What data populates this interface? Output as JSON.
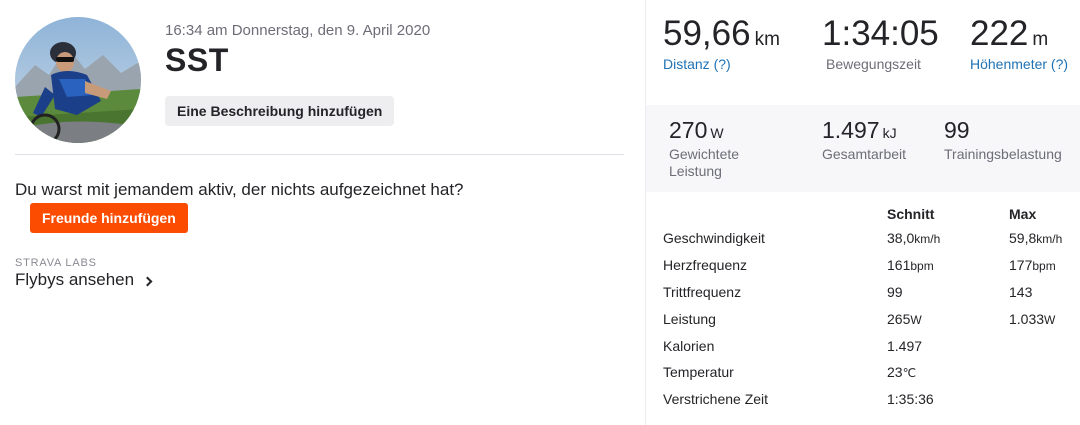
{
  "activity": {
    "timestamp": "16:34 am Donnerstag, den 9. April 2020",
    "name": "SST",
    "add_description_label": "Eine Beschreibung hinzufügen"
  },
  "social": {
    "prompt": "Du warst mit jemandem aktiv, der nichts aufgezeichnet hat?",
    "add_friends_label": "Freunde hinzufügen"
  },
  "labs": {
    "label": "STRAVA LABS",
    "flybys_label": "Flybys ansehen"
  },
  "summary": {
    "distance": {
      "value": "59,66",
      "unit": "km",
      "label": "Distanz (?)"
    },
    "moving_time": {
      "value": "1:34:05",
      "label": "Bewegungszeit"
    },
    "elevation": {
      "value": "222",
      "unit": "m",
      "label": "Höhenmeter (?)"
    }
  },
  "secondary": {
    "weighted_power": {
      "value": "270",
      "unit": "W",
      "label_line1": "Gewichtete",
      "label_line2": "Leistung"
    },
    "total_work": {
      "value": "1.497",
      "unit": "kJ",
      "label": "Gesamtarbeit"
    },
    "training_load": {
      "value": "99",
      "label": "Trainingsbelastung"
    }
  },
  "table": {
    "headers": {
      "avg": "Schnitt",
      "max": "Max"
    },
    "rows": [
      {
        "label": "Geschwindigkeit",
        "avg": "38,0",
        "avg_unit": "km/h",
        "max": "59,8",
        "max_unit": "km/h"
      },
      {
        "label": "Herzfrequenz",
        "avg": "161",
        "avg_unit": "bpm",
        "max": "177",
        "max_unit": "bpm"
      },
      {
        "label": "Trittfrequenz",
        "avg": "99",
        "avg_unit": "",
        "max": "143",
        "max_unit": ""
      },
      {
        "label": "Leistung",
        "avg": "265",
        "avg_unit": "W",
        "max": "1.033",
        "max_unit": "W"
      },
      {
        "label": "Kalorien",
        "avg": "1.497",
        "avg_unit": "",
        "max": "",
        "max_unit": ""
      },
      {
        "label": "Temperatur",
        "avg": "23",
        "avg_unit": "℃",
        "max": "",
        "max_unit": ""
      },
      {
        "label": "Verstrichene Zeit",
        "avg": "1:35:36",
        "avg_unit": "",
        "max": "",
        "max_unit": ""
      }
    ]
  },
  "colors": {
    "brand_orange": "#fc4c02",
    "link_blue": "#1f72b4",
    "text_dark": "#242428",
    "text_muted": "#6d6d78"
  }
}
